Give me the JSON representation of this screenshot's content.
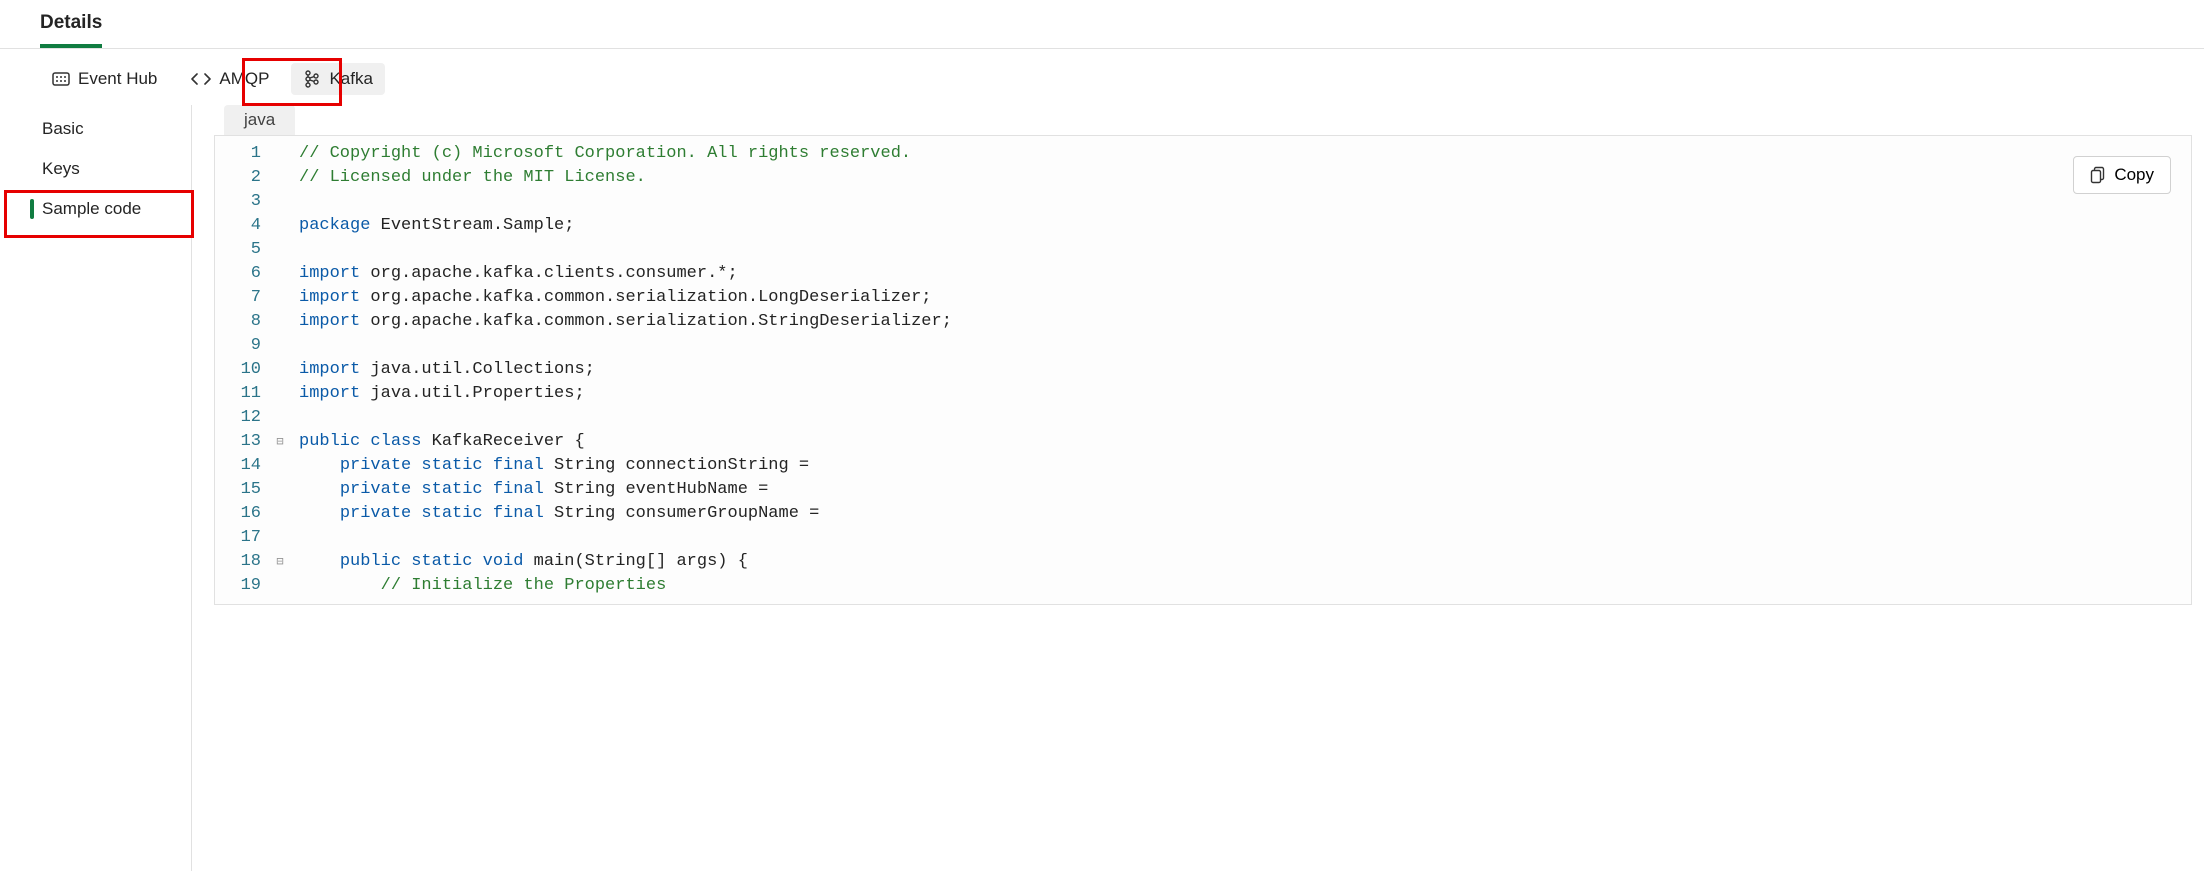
{
  "header": {
    "tab": "Details"
  },
  "toolbar": {
    "items": [
      {
        "label": "Event Hub"
      },
      {
        "label": "AMQP"
      },
      {
        "label": "Kafka"
      }
    ]
  },
  "sidebar": {
    "items": [
      {
        "label": "Basic"
      },
      {
        "label": "Keys"
      },
      {
        "label": "Sample code"
      }
    ]
  },
  "code": {
    "language": "java",
    "copy_label": "Copy",
    "lines": [
      {
        "n": 1,
        "fold": "",
        "segments": [
          {
            "cls": "c-comment",
            "text": "// Copyright (c) Microsoft Corporation. All rights reserved."
          }
        ]
      },
      {
        "n": 2,
        "fold": "",
        "segments": [
          {
            "cls": "c-comment",
            "text": "// Licensed under the MIT License."
          }
        ]
      },
      {
        "n": 3,
        "fold": "",
        "segments": [
          {
            "cls": "c-plain",
            "text": ""
          }
        ]
      },
      {
        "n": 4,
        "fold": "",
        "segments": [
          {
            "cls": "c-key",
            "text": "package"
          },
          {
            "cls": "c-plain",
            "text": " EventStream.Sample;"
          }
        ]
      },
      {
        "n": 5,
        "fold": "",
        "segments": [
          {
            "cls": "c-plain",
            "text": ""
          }
        ]
      },
      {
        "n": 6,
        "fold": "",
        "segments": [
          {
            "cls": "c-key",
            "text": "import"
          },
          {
            "cls": "c-plain",
            "text": " org.apache.kafka.clients.consumer.*;"
          }
        ]
      },
      {
        "n": 7,
        "fold": "",
        "segments": [
          {
            "cls": "c-key",
            "text": "import"
          },
          {
            "cls": "c-plain",
            "text": " org.apache.kafka.common.serialization.LongDeserializer;"
          }
        ]
      },
      {
        "n": 8,
        "fold": "",
        "segments": [
          {
            "cls": "c-key",
            "text": "import"
          },
          {
            "cls": "c-plain",
            "text": " org.apache.kafka.common.serialization.StringDeserializer;"
          }
        ]
      },
      {
        "n": 9,
        "fold": "",
        "segments": [
          {
            "cls": "c-plain",
            "text": ""
          }
        ]
      },
      {
        "n": 10,
        "fold": "",
        "segments": [
          {
            "cls": "c-key",
            "text": "import"
          },
          {
            "cls": "c-plain",
            "text": " java.util.Collections;"
          }
        ]
      },
      {
        "n": 11,
        "fold": "",
        "segments": [
          {
            "cls": "c-key",
            "text": "import"
          },
          {
            "cls": "c-plain",
            "text": " java.util.Properties;"
          }
        ]
      },
      {
        "n": 12,
        "fold": "",
        "segments": [
          {
            "cls": "c-plain",
            "text": ""
          }
        ]
      },
      {
        "n": 13,
        "fold": "⊟",
        "segments": [
          {
            "cls": "c-key",
            "text": "public class"
          },
          {
            "cls": "c-plain",
            "text": " KafkaReceiver {"
          }
        ]
      },
      {
        "n": 14,
        "fold": "",
        "segments": [
          {
            "cls": "c-plain",
            "text": "    "
          },
          {
            "cls": "c-key",
            "text": "private static final"
          },
          {
            "cls": "c-plain",
            "text": " String connectionString ="
          }
        ]
      },
      {
        "n": 15,
        "fold": "",
        "segments": [
          {
            "cls": "c-plain",
            "text": "    "
          },
          {
            "cls": "c-key",
            "text": "private static final"
          },
          {
            "cls": "c-plain",
            "text": " String eventHubName ="
          }
        ]
      },
      {
        "n": 16,
        "fold": "",
        "segments": [
          {
            "cls": "c-plain",
            "text": "    "
          },
          {
            "cls": "c-key",
            "text": "private static final"
          },
          {
            "cls": "c-plain",
            "text": " String consumerGroupName ="
          }
        ]
      },
      {
        "n": 17,
        "fold": "",
        "segments": [
          {
            "cls": "c-plain",
            "text": ""
          }
        ]
      },
      {
        "n": 18,
        "fold": "⊟",
        "segments": [
          {
            "cls": "c-plain",
            "text": "    "
          },
          {
            "cls": "c-key",
            "text": "public static void"
          },
          {
            "cls": "c-plain",
            "text": " main(String[] args) {"
          }
        ]
      },
      {
        "n": 19,
        "fold": "",
        "segments": [
          {
            "cls": "c-plain",
            "text": "        "
          },
          {
            "cls": "c-comment",
            "text": "// Initialize the Properties"
          }
        ]
      }
    ]
  }
}
